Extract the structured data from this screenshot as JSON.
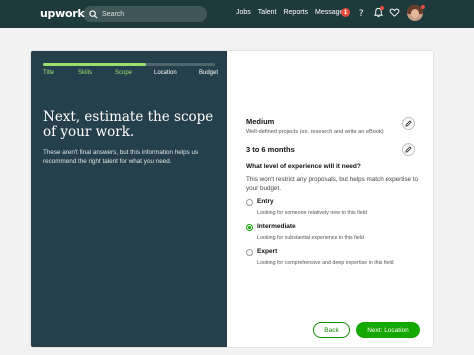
{
  "nav": {
    "logo": "upwork",
    "search_placeholder": "Search",
    "links": [
      "Jobs",
      "Talent",
      "Reports",
      "Messages"
    ],
    "messages_badge": "1",
    "icons": [
      "search-icon",
      "help-icon",
      "bell-icon",
      "heart-icon"
    ]
  },
  "left_panel": {
    "steps": [
      "Title",
      "Skills",
      "Scope",
      "Location",
      "Budget"
    ],
    "current_step": 3,
    "progress": 0.6,
    "headline": "Next, estimate the scope of your work.",
    "subtext": "These aren't final answers, but this information helps us recommend the right talent for what you need."
  },
  "scope": {
    "size_title": "Medium",
    "size_desc": "Well-defined projects (ex. research and write an eBook)",
    "duration_title": "3 to 6 months"
  },
  "experience": {
    "question": "What level of experience will it need?",
    "help": "This won't restrict any proposals, but helps match expertise to your budget.",
    "options": [
      {
        "label": "Entry",
        "desc": "Looking for someone relatively new to this field",
        "selected": false
      },
      {
        "label": "Intermediate",
        "desc": "Looking for substantial experience in this field",
        "selected": true
      },
      {
        "label": "Expert",
        "desc": "Looking for comprehensive and deep expertise in this field",
        "selected": false
      }
    ]
  },
  "actions": {
    "back": "Back",
    "next": "Next: Location"
  },
  "colors": {
    "nav_bg": "#1f3a3d",
    "panel_bg": "#263f4c",
    "accent_green": "#14a800",
    "progress_green": "#9ae06f"
  }
}
